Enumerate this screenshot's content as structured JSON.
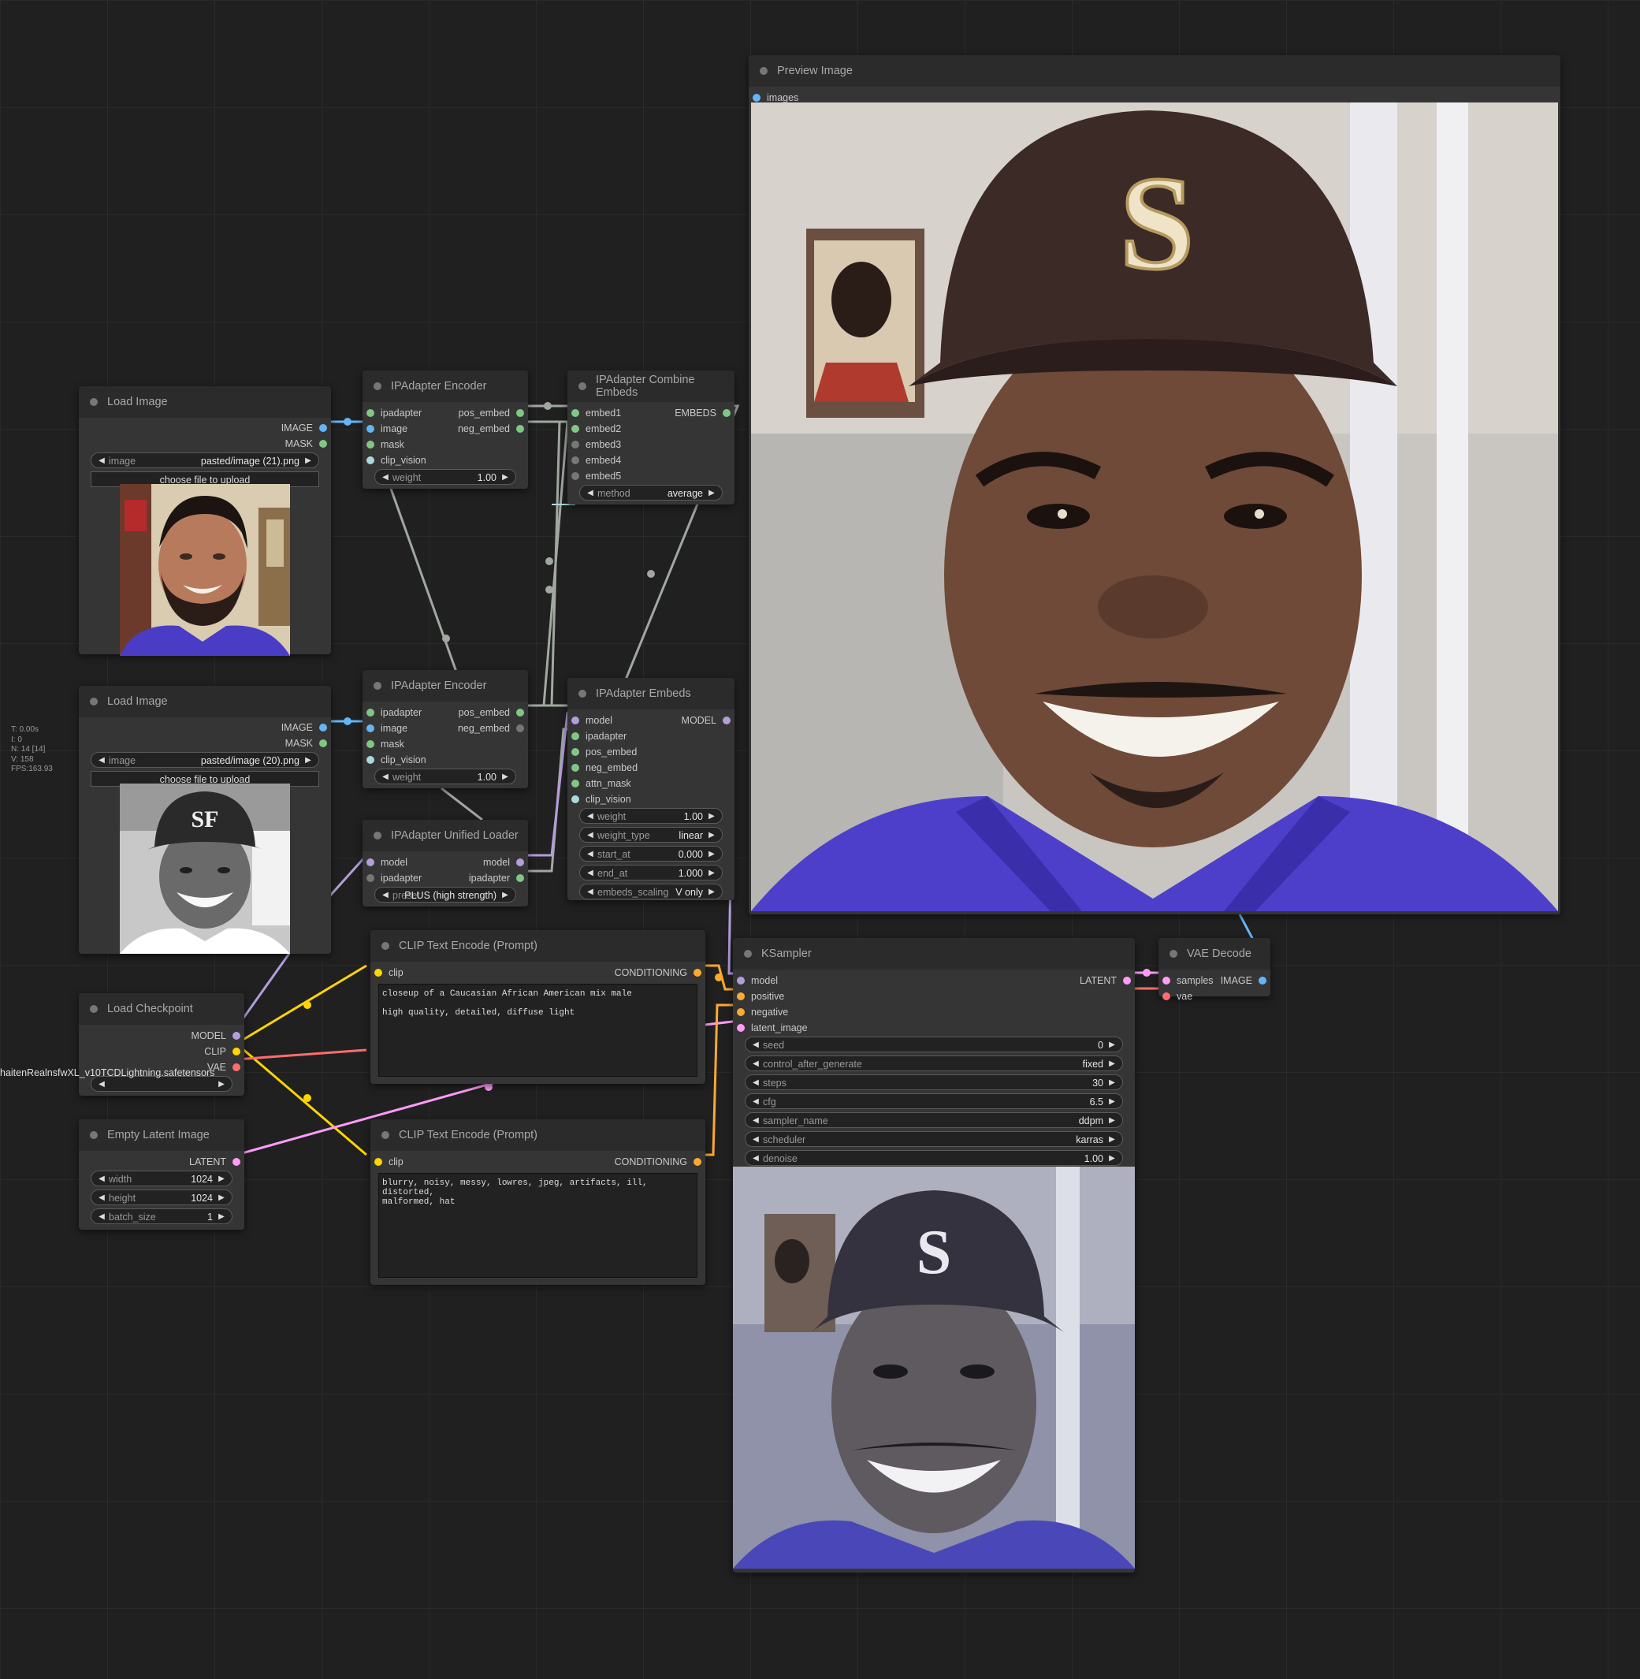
{
  "stats": [
    "T: 0.00s",
    "I: 0",
    "N: 14 [14]",
    "V: 158",
    "FPS:163.93"
  ],
  "colors": {
    "image": "#64b5f6",
    "mask": "#81c784",
    "model": "#b39ddb",
    "clip": "#ffd500",
    "vae": "#ff6e6e",
    "latent": "#ff9cf9",
    "conditioning": "#ffa931",
    "embeds": "#a0a8a0",
    "clip_vision": "#a8dadc"
  },
  "load_image_1": {
    "title": "Load Image",
    "outputs": [
      "IMAGE",
      "MASK"
    ],
    "image_label": "image",
    "image_value": "pasted/image (21).png",
    "upload_label": "choose file to upload"
  },
  "load_image_2": {
    "title": "Load Image",
    "outputs": [
      "IMAGE",
      "MASK"
    ],
    "image_label": "image",
    "image_value": "pasted/image (20).png",
    "upload_label": "choose file to upload"
  },
  "ipadapter_encoder_1": {
    "title": "IPAdapter Encoder",
    "inputs": [
      "ipadapter",
      "image",
      "mask",
      "clip_vision"
    ],
    "outputs": [
      "pos_embed",
      "neg_embed"
    ],
    "weight_label": "weight",
    "weight_value": "1.00"
  },
  "ipadapter_encoder_2": {
    "title": "IPAdapter Encoder",
    "inputs": [
      "ipadapter",
      "image",
      "mask",
      "clip_vision"
    ],
    "outputs": [
      "pos_embed",
      "neg_embed"
    ],
    "weight_label": "weight",
    "weight_value": "1.00"
  },
  "ipadapter_unified_loader": {
    "title": "IPAdapter Unified Loader",
    "inputs": [
      "model",
      "ipadapter"
    ],
    "outputs": [
      "model",
      "ipadapter"
    ],
    "preset_label": "preset",
    "preset_value": "PLUS (high strength)"
  },
  "ipadapter_combine": {
    "title": "IPAdapter Combine Embeds",
    "inputs": [
      "embed1",
      "embed2",
      "embed3",
      "embed4",
      "embed5"
    ],
    "output": "EMBEDS",
    "method_label": "method",
    "method_value": "average"
  },
  "ipadapter_embeds": {
    "title": "IPAdapter Embeds",
    "inputs": [
      "model",
      "ipadapter",
      "pos_embed",
      "neg_embed",
      "attn_mask",
      "clip_vision"
    ],
    "output": "MODEL",
    "widgets": [
      {
        "label": "weight",
        "value": "1.00"
      },
      {
        "label": "weight_type",
        "value": "linear"
      },
      {
        "label": "start_at",
        "value": "0.000"
      },
      {
        "label": "end_at",
        "value": "1.000"
      },
      {
        "label": "embeds_scaling",
        "value": "V only"
      }
    ]
  },
  "load_checkpoint": {
    "title": "Load Checkpoint",
    "outputs": [
      "MODEL",
      "CLIP",
      "VAE"
    ],
    "ckpt_value": "haitenRealnsfwXL_v10TCDLightning.safetensors"
  },
  "empty_latent": {
    "title": "Empty Latent Image",
    "output": "LATENT",
    "widgets": [
      {
        "label": "width",
        "value": "1024"
      },
      {
        "label": "height",
        "value": "1024"
      },
      {
        "label": "batch_size",
        "value": "1"
      }
    ]
  },
  "clip_text_pos": {
    "title": "CLIP Text Encode (Prompt)",
    "input": "clip",
    "output": "CONDITIONING",
    "text": "closeup of a Caucasian African American mix male\n\nhigh quality, detailed, diffuse light"
  },
  "clip_text_neg": {
    "title": "CLIP Text Encode (Prompt)",
    "input": "clip",
    "output": "CONDITIONING",
    "text": "blurry, noisy, messy, lowres, jpeg, artifacts, ill, distorted,\nmalformed, hat"
  },
  "ksampler": {
    "title": "KSampler",
    "inputs": [
      "model",
      "positive",
      "negative",
      "latent_image"
    ],
    "output": "LATENT",
    "widgets": [
      {
        "label": "seed",
        "value": "0"
      },
      {
        "label": "control_after_generate",
        "value": "fixed"
      },
      {
        "label": "steps",
        "value": "30"
      },
      {
        "label": "cfg",
        "value": "6.5"
      },
      {
        "label": "sampler_name",
        "value": "ddpm"
      },
      {
        "label": "scheduler",
        "value": "karras"
      },
      {
        "label": "denoise",
        "value": "1.00"
      }
    ]
  },
  "vae_decode": {
    "title": "VAE Decode",
    "inputs": [
      "samples",
      "vae"
    ],
    "output": "IMAGE"
  },
  "preview_image": {
    "title": "Preview Image",
    "input": "images",
    "hat_letter": "S"
  },
  "photo_2": {
    "cap_logo": "SF"
  },
  "ksampler_preview": {
    "hat_letter": "S"
  }
}
